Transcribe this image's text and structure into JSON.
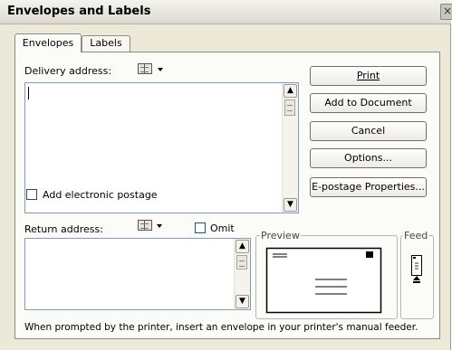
{
  "window": {
    "title": "Envelopes and Labels",
    "close_glyph": "×"
  },
  "tabs": [
    {
      "label": "Envelopes",
      "active": true
    },
    {
      "label": "Labels",
      "active": false
    }
  ],
  "delivery": {
    "label": "Delivery address:",
    "value": "",
    "address_book_icon": "address-book-icon"
  },
  "postage": {
    "label": "Add electronic postage",
    "checked": false
  },
  "return": {
    "label": "Return address:",
    "value": "",
    "omit_label": "Omit",
    "omit_checked": false,
    "address_book_icon": "address-book-icon"
  },
  "buttons": {
    "print": "Print",
    "add_to_document": "Add to Document",
    "cancel": "Cancel",
    "options": "Options...",
    "epostage": "E-postage Properties..."
  },
  "preview": {
    "title": "Preview"
  },
  "feed": {
    "title": "Feed"
  },
  "hint": "When prompted by the printer, insert an envelope in your printer's manual feeder.",
  "scroll_glyphs": {
    "up": "▲",
    "down": "▼"
  },
  "colors": {
    "face": "#ece9d8",
    "panel": "#fbfbf8",
    "input_border": "#7f9db9"
  }
}
